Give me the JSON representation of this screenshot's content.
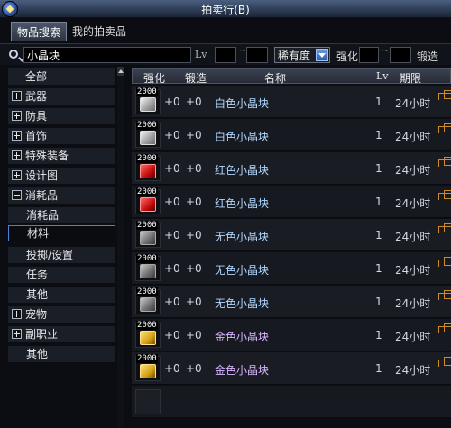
{
  "window": {
    "title": "拍卖行(B)"
  },
  "tabs": [
    {
      "label": "物品搜索",
      "active": true
    },
    {
      "label": "我的拍卖品",
      "active": false
    }
  ],
  "search": {
    "value": "小晶块",
    "lv_label": "Lv",
    "level_min": "",
    "level_max": "",
    "rarity": "稀有度",
    "strengthen_label": "强化",
    "forge_label": "锻造",
    "tilde": "~"
  },
  "categories": [
    {
      "label": "全部",
      "expander": "none"
    },
    {
      "label": "武器",
      "expander": "plus"
    },
    {
      "label": "防具",
      "expander": "plus"
    },
    {
      "label": "首饰",
      "expander": "plus"
    },
    {
      "label": "特殊装备",
      "expander": "plus"
    },
    {
      "label": "设计图",
      "expander": "plus"
    },
    {
      "label": "消耗品",
      "expander": "minus"
    },
    {
      "label": "消耗品",
      "expander": "sub"
    },
    {
      "label": "材料",
      "expander": "sub",
      "selected": true
    },
    {
      "label": "投掷/设置",
      "expander": "sub"
    },
    {
      "label": "任务",
      "expander": "sub"
    },
    {
      "label": "其他",
      "expander": "sub"
    },
    {
      "label": "宠物",
      "expander": "plus"
    },
    {
      "label": "副职业",
      "expander": "plus"
    },
    {
      "label": "其他",
      "expander": "none"
    }
  ],
  "table": {
    "headers": {
      "strengthen": "强化",
      "forge": "锻造",
      "name": "名称",
      "lv": "Lv",
      "expire": "期限"
    },
    "rows": [
      {
        "qty": "2000",
        "icon": "white-crystal-icon",
        "color": "white",
        "strengthen": "+0",
        "forge": "+0",
        "name": "白色小晶块",
        "lv": "1",
        "expire": "24小时"
      },
      {
        "qty": "2000",
        "icon": "white-crystal-icon",
        "color": "white",
        "strengthen": "+0",
        "forge": "+0",
        "name": "白色小晶块",
        "lv": "1",
        "expire": "24小时"
      },
      {
        "qty": "2000",
        "icon": "red-crystal-icon",
        "color": "red",
        "strengthen": "+0",
        "forge": "+0",
        "name": "红色小晶块",
        "lv": "1",
        "expire": "24小时"
      },
      {
        "qty": "2000",
        "icon": "red-crystal-icon",
        "color": "red",
        "strengthen": "+0",
        "forge": "+0",
        "name": "红色小晶块",
        "lv": "1",
        "expire": "24小时"
      },
      {
        "qty": "2000",
        "icon": "colorless-crystal-icon",
        "color": "colorless",
        "strengthen": "+0",
        "forge": "+0",
        "name": "无色小晶块",
        "lv": "1",
        "expire": "24小时"
      },
      {
        "qty": "2000",
        "icon": "colorless-crystal-icon",
        "color": "colorless",
        "strengthen": "+0",
        "forge": "+0",
        "name": "无色小晶块",
        "lv": "1",
        "expire": "24小时"
      },
      {
        "qty": "2000",
        "icon": "colorless-crystal-icon",
        "color": "colorless",
        "strengthen": "+0",
        "forge": "+0",
        "name": "无色小晶块",
        "lv": "1",
        "expire": "24小时"
      },
      {
        "qty": "2000",
        "icon": "gold-crystal-icon",
        "color": "gold",
        "strengthen": "+0",
        "forge": "+0",
        "name": "金色小晶块",
        "lv": "1",
        "expire": "24小时"
      },
      {
        "qty": "2000",
        "icon": "gold-crystal-icon",
        "color": "gold",
        "strengthen": "+0",
        "forge": "+0",
        "name": "金色小晶块",
        "lv": "1",
        "expire": "24小时"
      }
    ]
  }
}
